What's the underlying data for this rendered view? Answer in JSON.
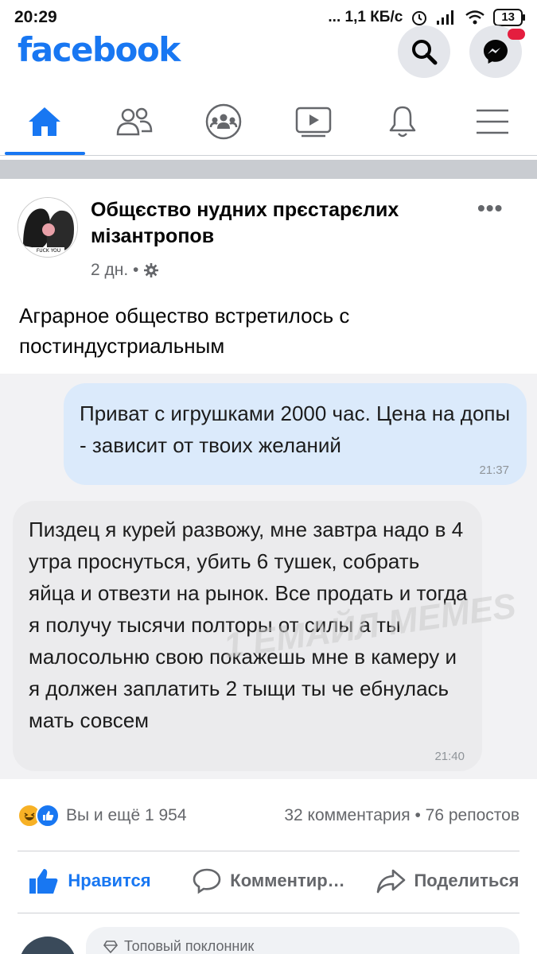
{
  "status_bar": {
    "time": "20:29",
    "network": "... 1,1 КБ/с",
    "battery": "13"
  },
  "header": {
    "logo": "facebook",
    "search_icon": "search-icon",
    "messenger_icon": "messenger-icon"
  },
  "nav": {
    "tabs": [
      {
        "id": "home",
        "icon": "home-icon",
        "active": true
      },
      {
        "id": "friends",
        "icon": "friends-icon",
        "active": false
      },
      {
        "id": "groups",
        "icon": "groups-icon",
        "active": false
      },
      {
        "id": "watch",
        "icon": "video-icon",
        "active": false
      },
      {
        "id": "notifications",
        "icon": "bell-icon",
        "active": false
      },
      {
        "id": "menu",
        "icon": "menu-icon",
        "active": false
      }
    ]
  },
  "post": {
    "group_name": "Общєство нудних прєстарєлих мізантропов",
    "time": "2 дн. •",
    "more": "•••",
    "text": "Аграрное общество встретилось с постиндустриальным",
    "avatar_caption": "FUCK YOU",
    "image": {
      "outgoing_message": "Приват с игрушками 2000 час. Цена на допы - зависит от твоих желаний",
      "outgoing_time": "21:37",
      "incoming_message": "Пиздец я курей развожу, мне завтра надо в 4 утра проснуться, убить 6 тушек, собрать яйца и отвезти на рынок. Все продать и тогда я получу тысячи полторы от силы а ты малосольню свою покажешь мне в камеру и я должен заплатить 2 тыщи ты че ебнулась мать совсем",
      "incoming_time": "21:40",
      "watermark": "1 ЕМАЙЛ MEMES"
    },
    "reactions": {
      "summary": "Вы и ещё 1 954",
      "stats": "32 комментария • 76 репостов",
      "colors": {
        "haha": "#f7b125",
        "like": "#1877f2"
      }
    },
    "actions": {
      "like": "Нравится",
      "comment": "Комментир…",
      "share": "Поделиться"
    },
    "top_comment": {
      "badge": "Топовый поклонник"
    }
  },
  "colors": {
    "brand": "#1877f2",
    "muted": "#65676b"
  }
}
